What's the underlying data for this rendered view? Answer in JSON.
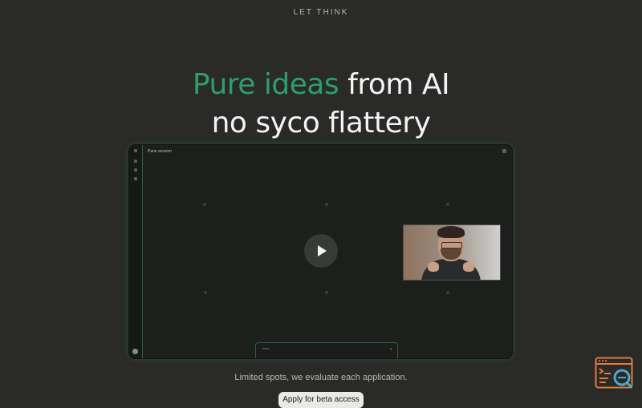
{
  "header": {
    "brand": "LET THINK"
  },
  "hero": {
    "line1_accent": "Pure ideas",
    "line1_rest": "from AI",
    "line2": "no syco flattery"
  },
  "video": {
    "session_title": "Pane session"
  },
  "footer": {
    "limited_text": "Limited spots, we evaluate each application.",
    "cta_label": "Apply for beta access"
  },
  "colors": {
    "accent": "#2f9e6a",
    "background": "#2a2a29",
    "frame_glow": "#37b46e",
    "widget": "#e07b3c"
  },
  "icons": {
    "play": "play-icon",
    "corner_widget": "terminal-search-icon"
  }
}
